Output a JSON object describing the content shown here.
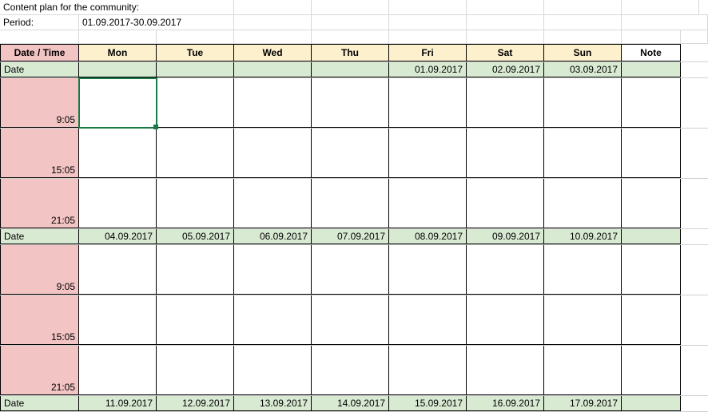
{
  "meta": {
    "title": "Content plan for the community:",
    "period_label": "Period:",
    "period_value": "01.09.2017-30.09.2017"
  },
  "header": {
    "date_time": "Date / Time",
    "days": [
      "Mon",
      "Tue",
      "Wed",
      "Thu",
      "Fri",
      "Sat",
      "Sun"
    ],
    "note": "Note"
  },
  "date_label": "Date",
  "times": [
    "9:05",
    "15:05",
    "21:05"
  ],
  "weeks": [
    {
      "dates": [
        "",
        "",
        "",
        "",
        "01.09.2017",
        "02.09.2017",
        "03.09.2017"
      ]
    },
    {
      "dates": [
        "04.09.2017",
        "05.09.2017",
        "06.09.2017",
        "07.09.2017",
        "08.09.2017",
        "09.09.2017",
        "10.09.2017"
      ]
    },
    {
      "dates": [
        "11.09.2017",
        "12.09.2017",
        "13.09.2017",
        "14.09.2017",
        "15.09.2017",
        "16.09.2017",
        "17.09.2017"
      ]
    }
  ]
}
